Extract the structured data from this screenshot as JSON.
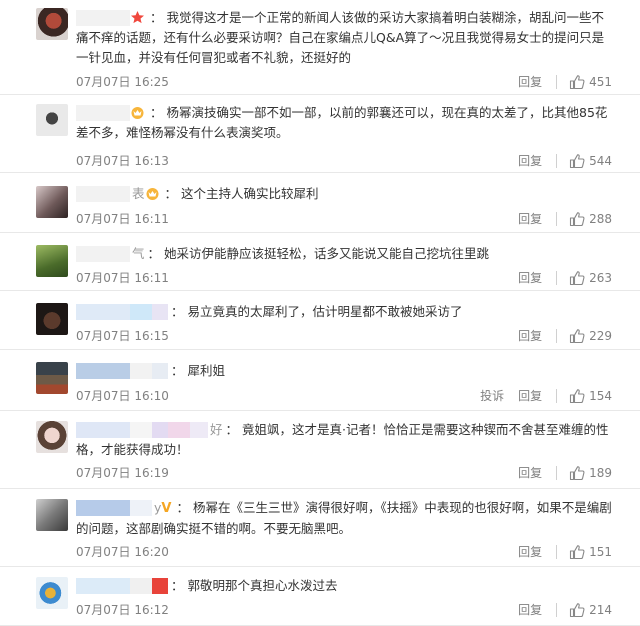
{
  "comments": [
    {
      "text": "我觉得这才是一个正常的新闻人该做的采访大家搞着明白装糊涂，胡乱问一些不痛不痒的话题，还有什么必要采访啊？自己在家编点儿Q&A算了～况且我觉得易女士的提问只是一针见血，并没有任何冒犯或者不礼貌，还挺好的",
      "time": "07月07日 16:25",
      "reply": "回复",
      "likes": "451",
      "name_colors": [
        "#f2f2f2"
      ],
      "badge": "star-badge-icon"
    },
    {
      "text": "杨幂演技确实一部不如一部，以前的郭襄还可以，现在真的太差了，比其他85花差不多，难怪杨幂没有什么表演奖项。",
      "time": "07月07日 16:13",
      "reply": "回复",
      "likes": "544",
      "name_colors": [
        "#f2f2f2"
      ],
      "badge": "crown-badge-icon"
    },
    {
      "text": "这个主持人确实比较犀利",
      "time": "07月07日 16:11",
      "reply": "回复",
      "likes": "288",
      "name_colors": [
        "#f2f2f2"
      ],
      "name_tail": "表",
      "badge": "crown-badge-icon"
    },
    {
      "text": "她采访伊能静应该挺轻松，话多又能说又能自己挖坑往里跳",
      "time": "07月07日 16:11",
      "reply": "回复",
      "likes": "263",
      "name_colors": [
        "#f2f2f2"
      ],
      "name_tail": "气"
    },
    {
      "text": "易立竟真的太犀利了，估计明星都不敢被她采访了",
      "time": "07月07日 16:15",
      "reply": "回复",
      "likes": "229",
      "name_colors": [
        "#dfeaf7",
        "#cfe8f9",
        "#e8e4f4"
      ]
    },
    {
      "text": "犀利姐",
      "time": "07月07日 16:10",
      "reply": "回复",
      "report": "投诉",
      "likes": "154",
      "name_colors": [
        "#b9cde6",
        "#f2f2f2",
        "#e7ecf3"
      ]
    },
    {
      "text": "竟姐飒，这才是真·记者！恰恰正是需要这种锲而不舍甚至难缠的性格，才能获得成功！",
      "time": "07月07日 16:19",
      "reply": "回复",
      "likes": "189",
      "name_colors": [
        "#dfe7f6",
        "#f5f5f5",
        "#e3dbf2",
        "#f1d7ea",
        "#eeeaf6"
      ],
      "name_tail": "好"
    },
    {
      "text": "杨幂在《三生三世》演得很好啊，《扶摇》中表现的也很好啊，如果不是编剧的问题，这部剧确实挺不错的啊。不要无脑黑吧。",
      "time": "07月07日 16:20",
      "reply": "回复",
      "likes": "151",
      "name_colors": [
        "#b6cbe9",
        "#eef2f8"
      ],
      "name_tail": "y",
      "badge": "v-badge-icon"
    },
    {
      "text": "郭敬明那个真担心水泼过去",
      "time": "07月07日 16:12",
      "reply": "回复",
      "likes": "214",
      "name_colors": [
        "#dcebf8",
        "#f0f0f0",
        "#e8433a"
      ]
    }
  ],
  "colors": {
    "text": "#333333",
    "meta": "#808080",
    "divider": "#e8e8e8"
  }
}
